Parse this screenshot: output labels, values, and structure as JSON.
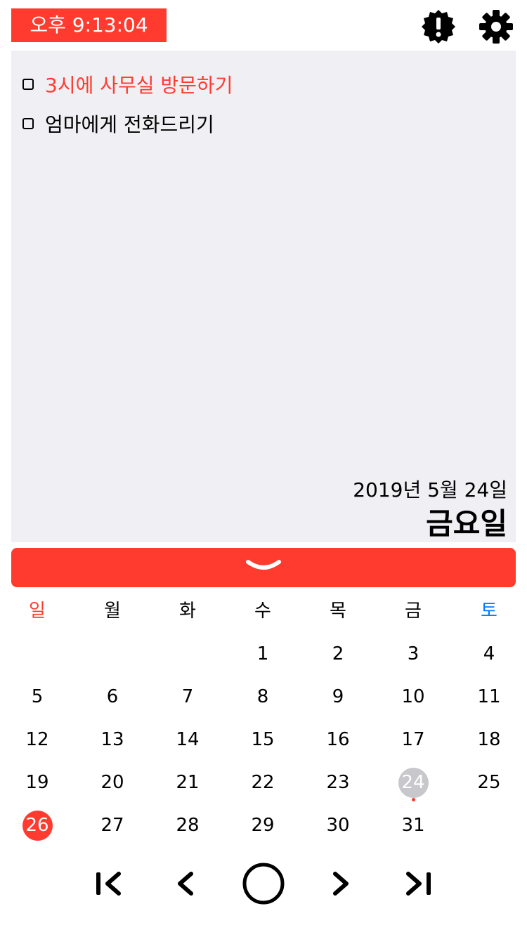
{
  "header": {
    "clock": "오후 9:13:04",
    "accent_color": "#ff3b30",
    "icons": [
      "alert-badge-icon",
      "gear-icon"
    ]
  },
  "memo": {
    "todos": [
      {
        "text": "3시에 사무실 방문하기",
        "color": "#ff3b30",
        "checked": false
      },
      {
        "text": "엄마에게 전화드리기",
        "color": "#000000",
        "checked": false
      }
    ],
    "date_text": "2019년 5월 24일",
    "weekday_text": "금요일"
  },
  "collapse_bar": {
    "icon": "chevron-down-icon"
  },
  "calendar": {
    "weekdays": [
      "일",
      "월",
      "화",
      "수",
      "목",
      "금",
      "토"
    ],
    "weeks": [
      [
        "",
        "",
        "",
        "1",
        "2",
        "3",
        "4"
      ],
      [
        "5",
        "6",
        "7",
        "8",
        "9",
        "10",
        "11"
      ],
      [
        "12",
        "13",
        "14",
        "15",
        "16",
        "17",
        "18"
      ],
      [
        "19",
        "20",
        "21",
        "22",
        "23",
        "24",
        "25"
      ],
      [
        "26",
        "27",
        "28",
        "29",
        "30",
        "31",
        ""
      ]
    ],
    "selected_day": "24",
    "today": "26",
    "event_days": [
      "24"
    ],
    "sunday_color": "#ff3b30",
    "saturday_color": "#007aff",
    "selected_color": "#c7c7cc"
  },
  "nav": {
    "icons": [
      "first-page-icon",
      "previous-icon",
      "home-circle-icon",
      "next-icon",
      "last-page-icon"
    ]
  }
}
